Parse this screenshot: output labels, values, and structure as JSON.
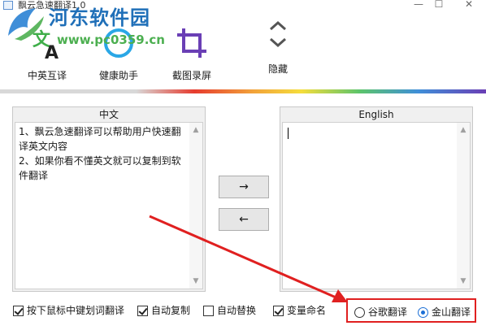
{
  "window": {
    "title": "飘云急速翻译1.0",
    "minimize_glyph": "—",
    "maximize_glyph": "☐",
    "close_glyph": "✕"
  },
  "watermark": {
    "text": "河东软件园",
    "url": "www.pc0359.cn"
  },
  "toolbar": {
    "items": [
      {
        "label": "中英互译",
        "icon": "translate-icon"
      },
      {
        "label": "健康助手",
        "icon": "health-ring-icon"
      },
      {
        "label": "截图录屏",
        "icon": "crop-icon"
      },
      {
        "label": "隐藏",
        "icon": "collapse-chevrons-icon"
      }
    ]
  },
  "source_panel": {
    "header": "中文",
    "lines": [
      "1、飘云急速翻译可以帮助用户快速翻",
      "译英文内容",
      "2、如果你看不懂英文就可以复制到软",
      "件翻译"
    ]
  },
  "target_panel": {
    "header": "English",
    "content": ""
  },
  "buttons": {
    "to_english": "→",
    "to_chinese": "←"
  },
  "options": {
    "checkboxes": [
      {
        "label": "按下鼠标中键划词翻译",
        "checked": true
      },
      {
        "label": "自动复制",
        "checked": true
      },
      {
        "label": "自动替换",
        "checked": false
      },
      {
        "label": "变量命名",
        "checked": true
      }
    ],
    "engines": [
      {
        "label": "谷歌翻译",
        "selected": false
      },
      {
        "label": "金山翻译",
        "selected": true
      }
    ]
  },
  "colors": {
    "annotation_red": "#e02020",
    "radio_blue": "#1c6fd6",
    "crop_purple": "#6a3fb5",
    "ring_blue": "#2aa7e6",
    "translate_green": "#3fae49"
  }
}
